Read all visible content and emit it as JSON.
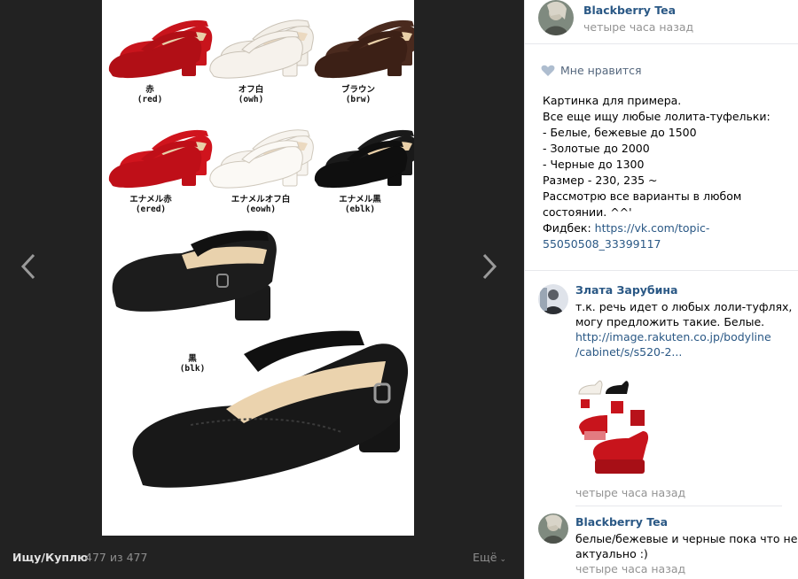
{
  "viewer": {
    "album_title": "Ищу/Куплю",
    "counter": "477 из 477",
    "more_label": "Ещё",
    "photo_labels": [
      {
        "jp": "赤",
        "code": "(red)"
      },
      {
        "jp": "オフ白",
        "code": "(owh)"
      },
      {
        "jp": "ブラウン",
        "code": "(brw)"
      },
      {
        "jp": "エナメル赤",
        "code": "(ered)"
      },
      {
        "jp": "エナメルオフ白",
        "code": "(eowh)"
      },
      {
        "jp": "エナメル黒",
        "code": "(eblk)"
      },
      {
        "jp": "黒",
        "code": "(blk)"
      }
    ],
    "shoe_colors": {
      "red": "#c8141c",
      "off_white": "#f1ede6",
      "brown": "#4a2a1e",
      "black": "#151515",
      "lining": "#e8cfa8"
    }
  },
  "post": {
    "author": "Blackberry Tea",
    "time": "четыре часа назад",
    "like_label": "Мне нравится",
    "text_lines": [
      "Картинка для примера.",
      "Все еще ищу любые лолита-туфельки:",
      "- Белые, бежевые до 1500",
      "- Золотые до 2000",
      "- Черные до 1300",
      "Размер - 230, 235 ~",
      "Рассмотрю все варианты в любом",
      "состоянии. ^^'"
    ],
    "feedback_label": "Фидбек: ",
    "feedback_link_1": "https://vk.com/topic-",
    "feedback_link_2": "55050508_33399117"
  },
  "comments": [
    {
      "author": "Злата Зарубина",
      "text_lines": [
        "т.к. речь идет о любых лоли-туфлях,",
        "могу предложить такие. Белые."
      ],
      "link_lines": [
        "http://image.rakuten.co.jp/bodyline",
        "/cabinet/s/s520-2..."
      ],
      "time": "четыре часа назад"
    },
    {
      "author": "Blackberry Tea",
      "text_lines": [
        "белые/бежевые и черные пока что не",
        "актуально :)"
      ],
      "time": "четыре часа назад"
    }
  ],
  "colors": {
    "link": "#2a5885",
    "muted": "#939393",
    "viewer_bg": "#222222"
  },
  "icons": [
    "chevron-left-icon",
    "chevron-right-icon",
    "heart-icon",
    "chevron-down-icon"
  ]
}
